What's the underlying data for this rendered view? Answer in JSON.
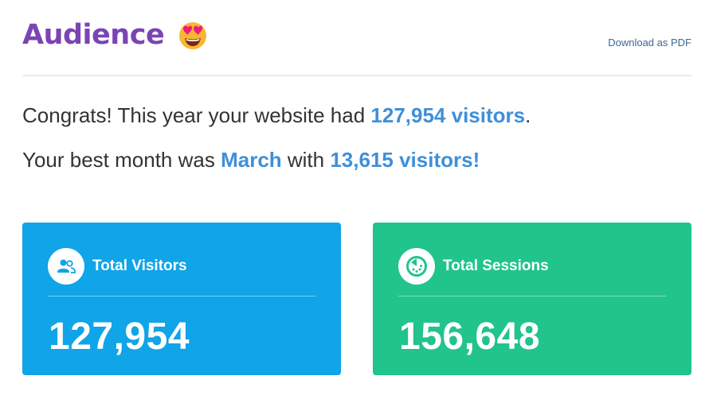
{
  "header": {
    "title": "Audience",
    "emoji_icon": "heart-eyes-emoji-icon",
    "download_label": "Download as PDF"
  },
  "summary": {
    "line1_prefix": "Congrats! This year your website had ",
    "line1_highlight": "127,954 visitors",
    "line1_suffix": ".",
    "line2_prefix": "Your best month was ",
    "line2_month": "March",
    "line2_middle": " with ",
    "line2_highlight": "13,615 visitors!"
  },
  "cards": [
    {
      "label": "Total Visitors",
      "value": "127,954",
      "icon": "users-icon",
      "color": "#10a4e8"
    },
    {
      "label": "Total Sessions",
      "value": "156,648",
      "icon": "timer-icon",
      "color": "#21c48b"
    }
  ],
  "colors": {
    "title": "#7a45b3",
    "highlight": "#3f8fd9",
    "link": "#3e6796"
  }
}
